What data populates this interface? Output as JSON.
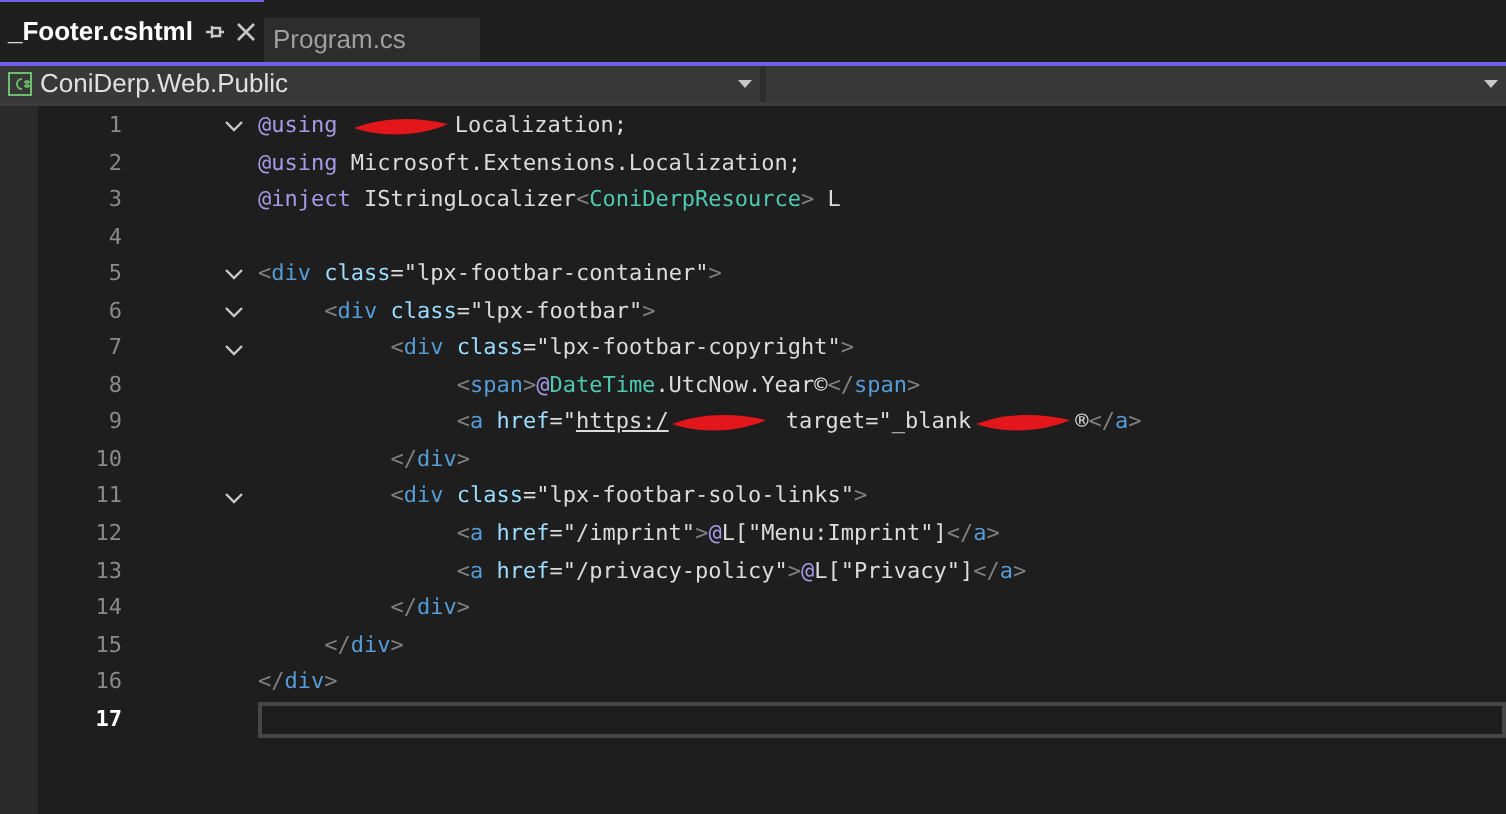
{
  "tabs": [
    {
      "label": "_Footer.cshtml",
      "selected": true,
      "pinnable": true,
      "closable": true
    },
    {
      "label": "Program.cs",
      "selected": false,
      "pinnable": false,
      "closable": false
    }
  ],
  "project_dropdown": {
    "value": "ConiDerp.Web.Public"
  },
  "editor": {
    "lines": [
      {
        "number": "1",
        "current": false,
        "expanded": true,
        "tokens": [
          {
            "kind": "directive",
            "text": "@using "
          },
          {
            "kind": "redacted"
          },
          {
            "kind": "plain",
            "text": "Localization;"
          }
        ]
      },
      {
        "number": "2",
        "current": false,
        "tokens": [
          {
            "kind": "directive",
            "text": "@using "
          },
          {
            "kind": "plain",
            "text": "Microsoft.Extensions.Localization;"
          }
        ]
      },
      {
        "number": "3",
        "current": false,
        "tokens": [
          {
            "kind": "directive",
            "text": "@inject "
          },
          {
            "kind": "plain",
            "text": "IStringLocalizer"
          },
          {
            "kind": "punct",
            "text": "<"
          },
          {
            "kind": "type",
            "text": "ConiDerpResource"
          },
          {
            "kind": "punct",
            "text": ">"
          },
          {
            "kind": "plain",
            "text": " L"
          }
        ]
      },
      {
        "number": "4",
        "current": false
      },
      {
        "number": "5",
        "current": false,
        "expanded": true,
        "tokens": [
          {
            "kind": "punct",
            "text": "<"
          },
          {
            "kind": "tag",
            "text": "div"
          },
          {
            "kind": "attr",
            "text": " class"
          },
          {
            "kind": "plain",
            "text": "=\"lpx-footbar-container\""
          },
          {
            "kind": "punct",
            "text": ">"
          }
        ],
        "children": [
          {
            "number": "6",
            "current": false,
            "expanded": true,
            "tokens": [
              {
                "kind": "punct",
                "text": "<"
              },
              {
                "kind": "tag",
                "text": "div"
              },
              {
                "kind": "attr",
                "text": " class"
              },
              {
                "kind": "plain",
                "text": "=\"lpx-footbar\""
              },
              {
                "kind": "punct",
                "text": ">"
              }
            ],
            "children": [
              {
                "number": "7",
                "current": false,
                "expanded": true,
                "tokens": [
                  {
                    "kind": "punct",
                    "text": "<"
                  },
                  {
                    "kind": "tag",
                    "text": "div"
                  },
                  {
                    "kind": "attr",
                    "text": " class"
                  },
                  {
                    "kind": "plain",
                    "text": "=\"lpx-footbar-copyright\""
                  },
                  {
                    "kind": "punct",
                    "text": ">"
                  }
                ],
                "children": [
                  {
                    "number": "8",
                    "current": false,
                    "tokens": [
                      {
                        "kind": "punct",
                        "text": "<"
                      },
                      {
                        "kind": "tag",
                        "text": "span"
                      },
                      {
                        "kind": "punct",
                        "text": ">"
                      },
                      {
                        "kind": "directive",
                        "text": "@"
                      },
                      {
                        "kind": "type",
                        "text": "DateTime"
                      },
                      {
                        "kind": "plain",
                        "text": ".UtcNow.Year©"
                      },
                      {
                        "kind": "punct",
                        "text": "</"
                      },
                      {
                        "kind": "tag",
                        "text": "span"
                      },
                      {
                        "kind": "punct",
                        "text": ">"
                      }
                    ]
                  },
                  {
                    "number": "9",
                    "current": false,
                    "tokens": [
                      {
                        "kind": "punct",
                        "text": "<"
                      },
                      {
                        "kind": "tag",
                        "text": "a"
                      },
                      {
                        "kind": "attr",
                        "text": " href"
                      },
                      {
                        "kind": "plain",
                        "text": "=\""
                      },
                      {
                        "kind": "link",
                        "text": "https:/"
                      },
                      {
                        "kind": "redacted"
                      },
                      {
                        "kind": "plain",
                        "text": " target=\"_blank"
                      },
                      {
                        "kind": "redacted"
                      },
                      {
                        "kind": "plain",
                        "text": "®"
                      },
                      {
                        "kind": "punct",
                        "text": "</"
                      },
                      {
                        "kind": "tag",
                        "text": "a"
                      },
                      {
                        "kind": "punct",
                        "text": ">"
                      }
                    ]
                  }
                ]
              },
              {
                "number": "10",
                "current": false,
                "tokens": [
                  {
                    "kind": "punct",
                    "text": "</"
                  },
                  {
                    "kind": "tag",
                    "text": "div"
                  },
                  {
                    "kind": "punct",
                    "text": ">"
                  }
                ]
              },
              {
                "number": "11",
                "current": false,
                "expanded": true,
                "tokens": [
                  {
                    "kind": "punct",
                    "text": "<"
                  },
                  {
                    "kind": "tag",
                    "text": "div"
                  },
                  {
                    "kind": "attr",
                    "text": " class"
                  },
                  {
                    "kind": "plain",
                    "text": "=\"lpx-footbar-solo-links\""
                  },
                  {
                    "kind": "punct",
                    "text": ">"
                  }
                ],
                "children": [
                  {
                    "number": "12",
                    "current": false,
                    "tokens": [
                      {
                        "kind": "punct",
                        "text": "<"
                      },
                      {
                        "kind": "tag",
                        "text": "a"
                      },
                      {
                        "kind": "attr",
                        "text": " href"
                      },
                      {
                        "kind": "plain",
                        "text": "=\"/imprint\""
                      },
                      {
                        "kind": "punct",
                        "text": ">"
                      },
                      {
                        "kind": "directive",
                        "text": "@"
                      },
                      {
                        "kind": "plain",
                        "text": "L[\"Menu:Imprint\"]"
                      },
                      {
                        "kind": "punct",
                        "text": "</"
                      },
                      {
                        "kind": "tag",
                        "text": "a"
                      },
                      {
                        "kind": "punct",
                        "text": ">"
                      }
                    ]
                  },
                  {
                    "number": "13",
                    "current": false,
                    "tokens": [
                      {
                        "kind": "punct",
                        "text": "<"
                      },
                      {
                        "kind": "tag",
                        "text": "a"
                      },
                      {
                        "kind": "attr",
                        "text": " href"
                      },
                      {
                        "kind": "plain",
                        "text": "=\"/privacy-policy\""
                      },
                      {
                        "kind": "punct",
                        "text": ">"
                      },
                      {
                        "kind": "directive",
                        "text": "@"
                      },
                      {
                        "kind": "plain",
                        "text": "L[\"Privacy\"]"
                      },
                      {
                        "kind": "punct",
                        "text": "</"
                      },
                      {
                        "kind": "tag",
                        "text": "a"
                      },
                      {
                        "kind": "punct",
                        "text": ">"
                      }
                    ]
                  }
                ]
              },
              {
                "number": "14",
                "current": false,
                "tokens": [
                  {
                    "kind": "punct",
                    "text": "</"
                  },
                  {
                    "kind": "tag",
                    "text": "div"
                  },
                  {
                    "kind": "punct",
                    "text": ">"
                  }
                ]
              }
            ]
          },
          {
            "number": "15",
            "current": false,
            "tokens": [
              {
                "kind": "punct",
                "text": "</"
              },
              {
                "kind": "tag",
                "text": "div"
              },
              {
                "kind": "punct",
                "text": ">"
              }
            ]
          }
        ]
      },
      {
        "number": "16",
        "current": false,
        "tokens": [
          {
            "kind": "punct",
            "text": "</"
          },
          {
            "kind": "tag",
            "text": "div"
          },
          {
            "kind": "punct",
            "text": ">"
          }
        ]
      },
      {
        "number": "17",
        "current": true
      }
    ]
  }
}
